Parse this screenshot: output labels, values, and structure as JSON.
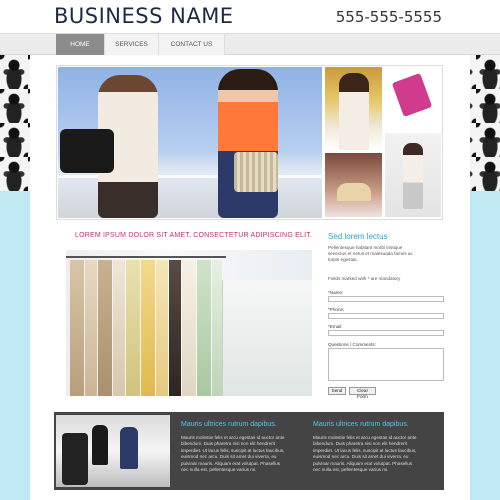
{
  "header": {
    "business_name": "BUSINESS NAME",
    "phone": "555-555-5555"
  },
  "nav": [
    {
      "label": "HOME",
      "active": true
    },
    {
      "label": "SERVICES",
      "active": false
    },
    {
      "label": "CONTACT US",
      "active": false
    }
  ],
  "main": {
    "headline": "LOREM IPSUM DOLOR SIT AMET, CONSECTETUR ADIPISCING ELIT."
  },
  "form": {
    "title": "Sed lorem lectus",
    "intro_lines": [
      "Pellentesque habitant morbi tristique",
      "senectus et netus et malesuada fames ac",
      "turpis egestas."
    ],
    "mandatory_note": "Fields marked with * are mandatory",
    "name_label": "*Name:",
    "phone_label": "*Phone:",
    "email_label": "*Email:",
    "comments_label": "Questions / Comments:",
    "send_label": "Send",
    "clear_label": "Clear Form"
  },
  "bottom": {
    "col1": {
      "title": "Mauris ultrices rutrum dapibus.",
      "lines": [
        "Mauris molestie felis et arcu egestas id auctor ante",
        "bibendum. Duis pharetra nisi non elit hendrerit",
        "imperdiet. Ut lacus felis, suscipit at luctus faucibus,",
        "euismod nec arcu. Duis sit amet dui viverra, eu",
        "pulvinar mauris. Aliquam erat volutpat. Phasellus",
        "nec nulla est, pellentesque varius mi."
      ]
    },
    "col2": {
      "title": "Mauris ultrices rutrum dapibus.",
      "lines": [
        "Mauris molestie felis et arcu egestas id auctor ante",
        "bibendum. Duis pharetra nisi non elit hendrerit",
        "imperdiet. Ut lacus felis, suscipit at luctus faucibus,",
        "euismod nec arcu. Duis sit amet dui viverra, eu",
        "pulvinar mauris. Aliquam erat volutpat. Phasellus",
        "nec nulla est, pellentesque varius mi."
      ]
    }
  },
  "colors": {
    "accent_pink": "#c0306f",
    "accent_blue": "#2aa3c7",
    "page_bg": "#bfe8f2",
    "dark_band": "#444444"
  }
}
